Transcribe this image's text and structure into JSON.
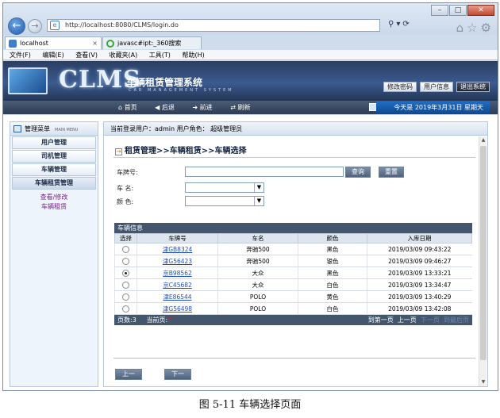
{
  "browser": {
    "url": "http://localhost:8080/CLMS/login.do",
    "tabs": [
      {
        "label": "localhost"
      },
      {
        "label": "javasc#ipt:_360搜索"
      }
    ],
    "menu": [
      "文件(F)",
      "编辑(E)",
      "查看(V)",
      "收藏夹(A)",
      "工具(T)",
      "帮助(H)"
    ]
  },
  "header": {
    "logo": "CLMS",
    "title": "车辆租赁管理系统",
    "subtitle": "CAR MANAGEMENT SYSTEM",
    "buttons": {
      "password": "修改密码",
      "userinfo": "用户信息",
      "logout": "退出系统"
    }
  },
  "toolbar": {
    "home": "首页",
    "back": "后退",
    "forward": "前进",
    "refresh": "刷新",
    "date": "今天是 2019年3月31日 星期天"
  },
  "sidebar": {
    "title": "管理菜单",
    "title_en": "MAIN MENU",
    "items": [
      {
        "label": "用户管理"
      },
      {
        "label": "司机管理"
      },
      {
        "label": "车辆管理"
      },
      {
        "label": "车辆租赁管理"
      }
    ],
    "sublinks": [
      {
        "label": "查看/修改"
      },
      {
        "label": "车辆租赁"
      }
    ]
  },
  "userbar": {
    "text": "当前登录用户：admin  用户角色：  超级管理员"
  },
  "breadcrumb": "租赁管理>>车辆租赁>>车辆选择",
  "form": {
    "plate_label": "车牌号:",
    "name_label": "车  名:",
    "color_label": "颜  色:",
    "query": "查询",
    "reset": "重置"
  },
  "table": {
    "caption": "车辆信息",
    "headers": [
      "选择",
      "车牌号",
      "车名",
      "颜色",
      "入库日期"
    ],
    "rows": [
      {
        "selected": false,
        "plate": "津GB8324",
        "name": "奔驰500",
        "color": "黑色",
        "date": "2019/03/09 09:43:22"
      },
      {
        "selected": false,
        "plate": "津G56423",
        "name": "奔驰500",
        "color": "银色",
        "date": "2019/03/09 09:46:27"
      },
      {
        "selected": true,
        "plate": "京B98562",
        "name": "大众",
        "color": "黑色",
        "date": "2019/03/09 13:33:21"
      },
      {
        "selected": false,
        "plate": "京C45682",
        "name": "大众",
        "color": "白色",
        "date": "2019/03/09 13:34:47"
      },
      {
        "selected": false,
        "plate": "津E86544",
        "name": "POLO",
        "color": "黄色",
        "date": "2019/03/09 13:40:29"
      },
      {
        "selected": false,
        "plate": "津G56498",
        "name": "POLO",
        "color": "白色",
        "date": "2019/03/09 13:42:08"
      }
    ],
    "footer": {
      "pages_label": "页数:",
      "pages": "3",
      "current_label": "当前页:",
      "current": "1",
      "first": "到第一页",
      "prev": "上一页",
      "next": "下一页",
      "last": "到最后页"
    }
  },
  "actions": {
    "prev_step": "上一步",
    "next_step": "下一步"
  },
  "caption": "图 5-11  车辆选择页面"
}
